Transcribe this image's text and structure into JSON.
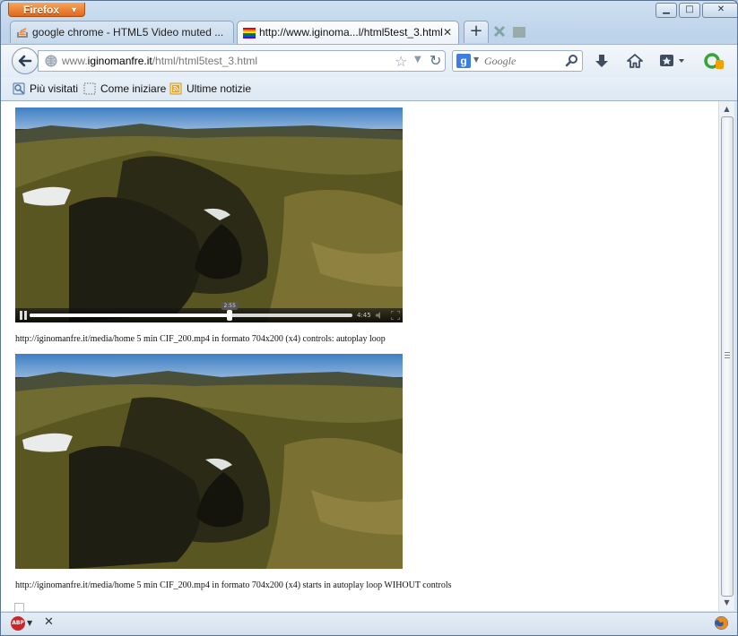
{
  "app": {
    "menu_button_label": "Firefox",
    "window_controls": {
      "minimize": "▁",
      "maximize": "□",
      "close": "✕"
    }
  },
  "tabs": [
    {
      "title": "google chrome - HTML5 Video muted ...",
      "icon": "stack-overflow-icon",
      "active": false
    },
    {
      "title": "http://www.iginoma...l/html5test_3.html",
      "icon": "rainbow-flag-icon",
      "active": true
    }
  ],
  "tab_close_glyph": "✕",
  "new_tab_glyph": "+",
  "navigation": {
    "url_prefix": "www.",
    "url_domain": "iginomanfre.it",
    "url_path": "/html/html5test_3.html",
    "search_engine_glyph": "g",
    "search_placeholder": "Google"
  },
  "bookmarks": [
    {
      "label": "Più visitati",
      "icon": "most-visited-icon"
    },
    {
      "label": "Come iniziare",
      "icon": "dotted-page-icon"
    },
    {
      "label": "Ultime notizie",
      "icon": "rss-feed-icon"
    }
  ],
  "videos": [
    {
      "has_controls": true,
      "progress": 0.62,
      "tooltip_time": "2:55",
      "duration": "4:45",
      "caption": "http://iginomanfre.it/media/home 5 min CIF_200.mp4 in formato 704x200 (x4) controls: autoplay loop"
    },
    {
      "has_controls": false,
      "caption": "http://iginomanfre.it/media/home 5 min CIF_200.mp4 in formato 704x200 (x4) starts in autoplay loop WIHOUT controls"
    }
  ],
  "addon_bar": {
    "abp_label": "ABP",
    "close_glyph": "✕"
  },
  "colors": {
    "firefox_orange": "#e2681c",
    "chrome_blue": "#bcd3ea",
    "abp_red": "#c9272b"
  }
}
